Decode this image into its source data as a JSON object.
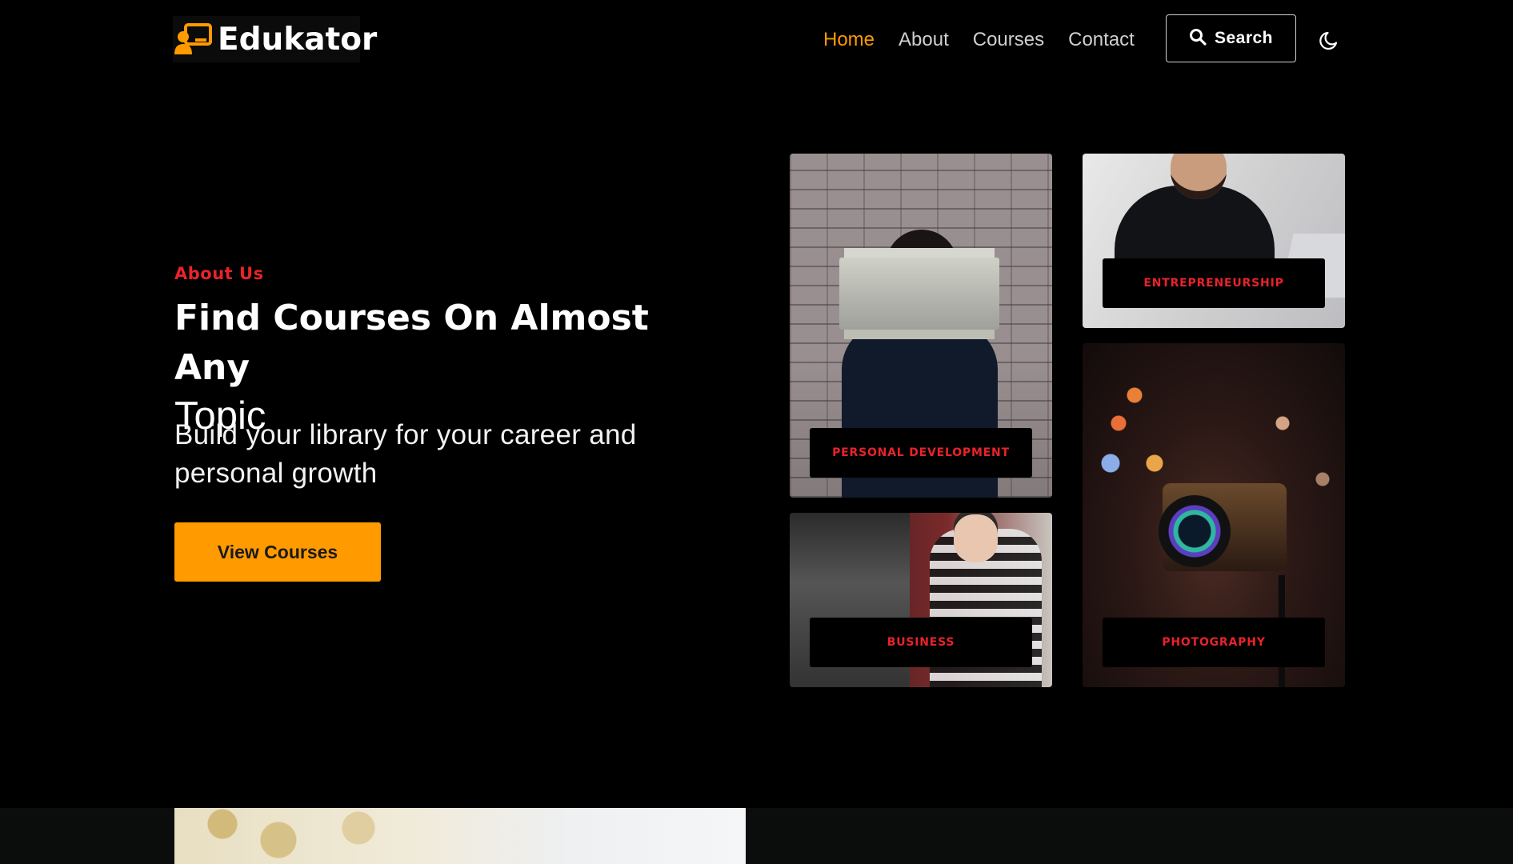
{
  "brand": {
    "name": "Edukator",
    "accent": "#ff9a00",
    "logo_icon": "teacher-board-icon"
  },
  "nav": {
    "items": [
      {
        "label": "Home",
        "active": true
      },
      {
        "label": "About",
        "active": false
      },
      {
        "label": "Courses",
        "active": false
      },
      {
        "label": "Contact",
        "active": false
      }
    ]
  },
  "search": {
    "label": "Search",
    "icon": "search-icon"
  },
  "theme_toggle": {
    "icon": "moon-icon"
  },
  "hero": {
    "eyebrow": "About Us",
    "title_bold": "Find Courses On Almost Any",
    "title_normal": "Topic",
    "subtitle": "Build your library for your career and personal growth",
    "cta_label": "View Courses"
  },
  "categories": [
    {
      "label": "PERSONAL DEVELOPMENT"
    },
    {
      "label": "ENTREPRENEURSHIP"
    },
    {
      "label": "BUSINESS"
    },
    {
      "label": "PHOTOGRAPHY"
    }
  ],
  "colors": {
    "accent": "#ff9a00",
    "tag_text": "#e8232a",
    "background": "#000000"
  }
}
